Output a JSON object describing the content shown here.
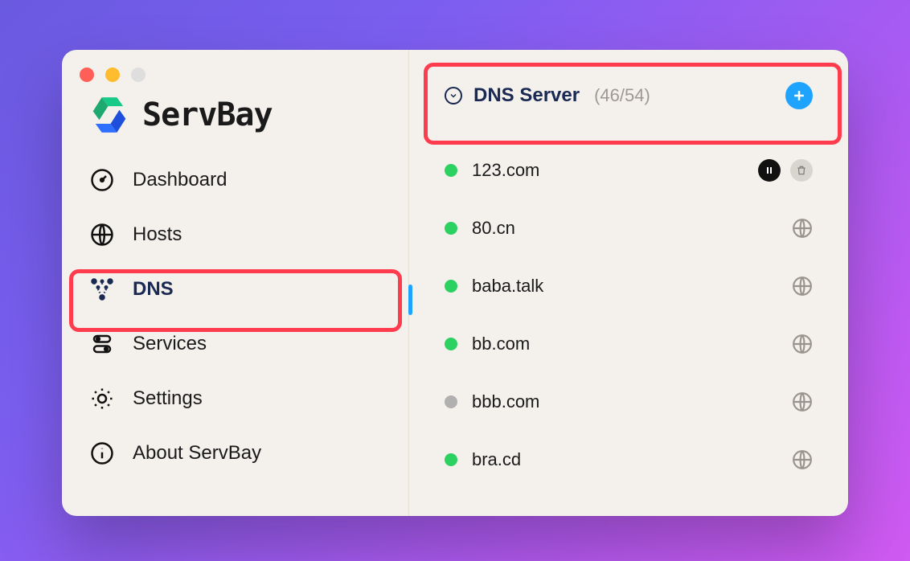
{
  "brand": {
    "name": "ServBay"
  },
  "sidebar": {
    "items": [
      {
        "label": "Dashboard"
      },
      {
        "label": "Hosts"
      },
      {
        "label": "DNS"
      },
      {
        "label": "Services"
      },
      {
        "label": "Settings"
      },
      {
        "label": "About ServBay"
      }
    ]
  },
  "dns": {
    "title": "DNS Server",
    "count": "(46/54)",
    "items": [
      {
        "name": "123.com",
        "status": "green",
        "actions": "pause-trash"
      },
      {
        "name": "80.cn",
        "status": "green",
        "actions": "globe"
      },
      {
        "name": "baba.talk",
        "status": "green",
        "actions": "globe"
      },
      {
        "name": "bb.com",
        "status": "green",
        "actions": "globe"
      },
      {
        "name": "bbb.com",
        "status": "gray",
        "actions": "globe"
      },
      {
        "name": "bra.cd",
        "status": "green",
        "actions": "globe"
      }
    ]
  }
}
